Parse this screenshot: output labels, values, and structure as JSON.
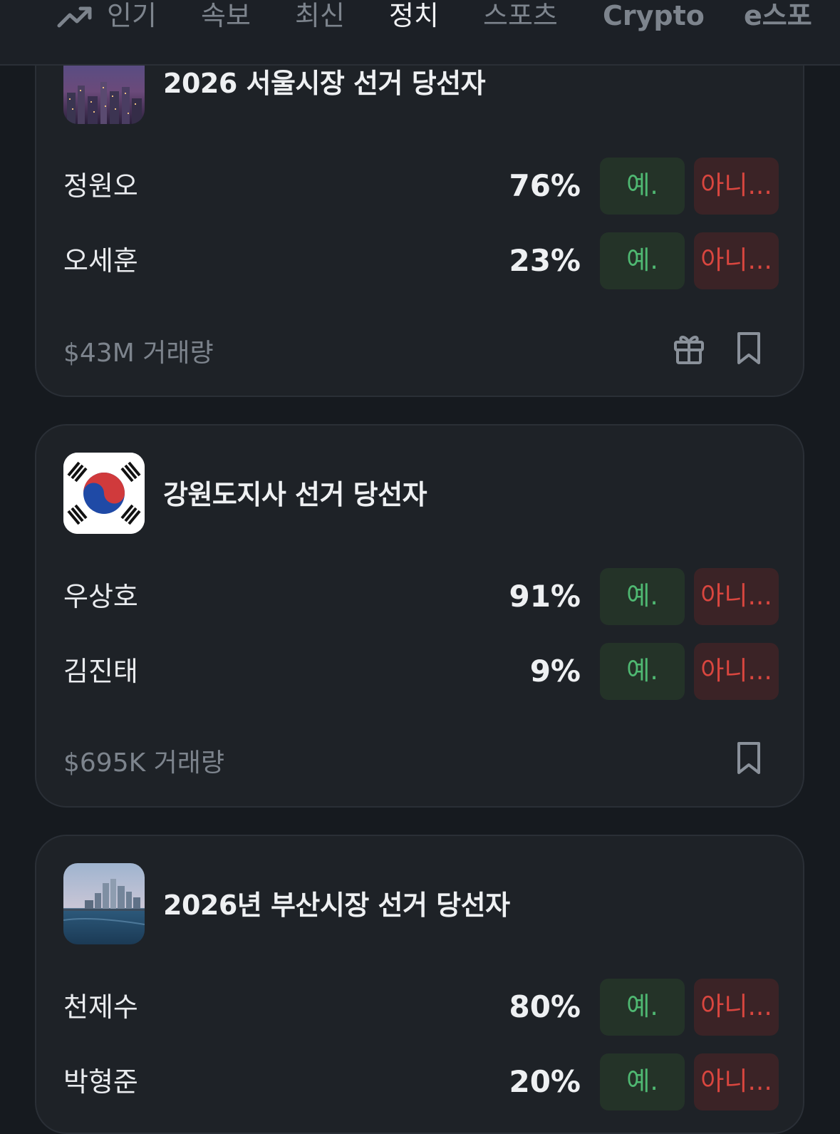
{
  "nav": {
    "tabs": [
      {
        "label": "인기"
      },
      {
        "label": "속보"
      },
      {
        "label": "최신"
      },
      {
        "label": "정치"
      },
      {
        "label": "스포츠"
      },
      {
        "label": "Crypto"
      },
      {
        "label": "e스포"
      }
    ],
    "active_tab": "정치"
  },
  "markets": [
    {
      "title": "2026 서울시장 선거 당선자",
      "image": "seoul-city-night-thumbnail",
      "candidates": [
        {
          "name": "정원오",
          "pct": "76%",
          "yes": "예.",
          "no": "아니..."
        },
        {
          "name": "오세훈",
          "pct": "23%",
          "yes": "예.",
          "no": "아니..."
        }
      ],
      "volume": "$43M 거래량"
    },
    {
      "title": "강원도지사 선거 당선자",
      "image": "korean-flag-thumbnail",
      "candidates": [
        {
          "name": "우상호",
          "pct": "91%",
          "yes": "예.",
          "no": "아니..."
        },
        {
          "name": "김진태",
          "pct": "9%",
          "yes": "예.",
          "no": "아니..."
        }
      ],
      "volume": "$695K 거래량"
    },
    {
      "title": "2026년 부산시장 선거 당선자",
      "image": "busan-skyline-thumbnail",
      "candidates": [
        {
          "name": "천제수",
          "pct": "80%",
          "yes": "예.",
          "no": "아니..."
        },
        {
          "name": "박형준",
          "pct": "20%",
          "yes": "예.",
          "no": "아니..."
        }
      ]
    }
  ],
  "colors": {
    "background": "#161a1f",
    "card": "#1e2227",
    "yes_text": "#4fb872",
    "yes_bg": "#243328",
    "no_text": "#d9463f",
    "no_bg": "#3b2326"
  }
}
